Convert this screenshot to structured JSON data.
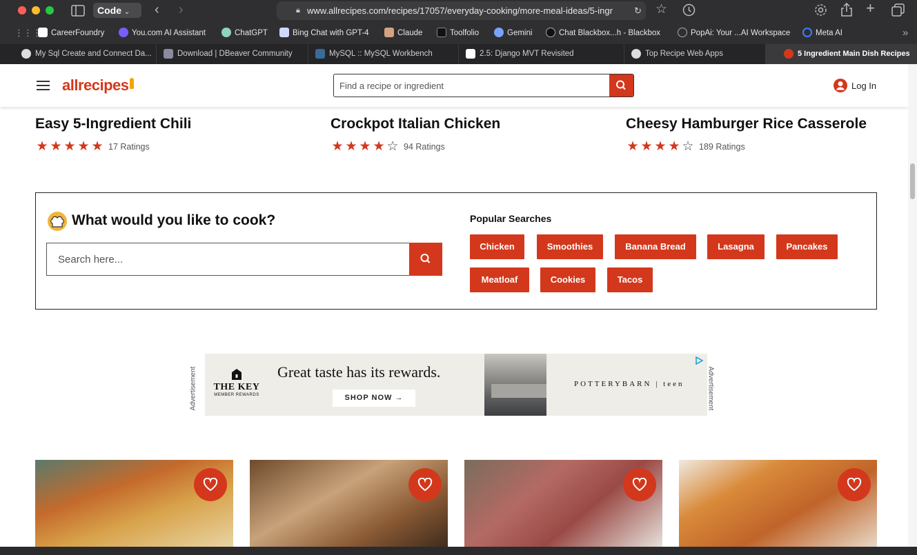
{
  "browser": {
    "app_menu": "Code",
    "url": "www.allrecipes.com/recipes/17057/everyday-cooking/more-meal-ideas/5-ingr",
    "bookmarks": [
      {
        "label": "CareerFoundry",
        "icon": "careerfoundry-icon"
      },
      {
        "label": "You.com AI Assistant",
        "icon": "youcom-icon"
      },
      {
        "label": "ChatGPT",
        "icon": "chatgpt-icon"
      },
      {
        "label": "Bing Chat with GPT-4",
        "icon": "bing-icon"
      },
      {
        "label": "Claude",
        "icon": "claude-icon"
      },
      {
        "label": "Toolfolio",
        "icon": "toolfolio-icon"
      },
      {
        "label": "Gemini",
        "icon": "gemini-icon"
      },
      {
        "label": "Chat Blackbox...h - Blackbox",
        "icon": "blackbox-icon"
      },
      {
        "label": "PopAi: Your ...AI Workspace",
        "icon": "globe-icon"
      },
      {
        "label": "Meta AI",
        "icon": "meta-icon"
      }
    ],
    "tabs": [
      {
        "label": "My Sql Create and Connect Da...",
        "active": false
      },
      {
        "label": "Download | DBeaver Community",
        "active": false
      },
      {
        "label": "MySQL :: MySQL Workbench",
        "active": false
      },
      {
        "label": "2.5: Django MVT Revisited",
        "active": false
      },
      {
        "label": "Top Recipe Web Apps",
        "active": false
      },
      {
        "label": "5 Ingredient Main Dish Recipes",
        "active": true
      }
    ]
  },
  "header": {
    "logo": "allrecipes",
    "search_placeholder": "Find a recipe or ingredient",
    "login_label": "Log In"
  },
  "recipes": [
    {
      "title": "Easy 5-Ingredient Chili",
      "stars": 5,
      "ratings": "17 Ratings"
    },
    {
      "title": "Crockpot Italian Chicken",
      "stars": 4,
      "ratings": "94 Ratings"
    },
    {
      "title": "Cheesy Hamburger Rice Casserole",
      "stars": 4,
      "ratings": "189 Ratings"
    }
  ],
  "cook": {
    "title": "What would you like to cook?",
    "search_placeholder": "Search here...",
    "popular_title": "Popular Searches",
    "chips": [
      "Chicken",
      "Smoothies",
      "Banana Bread",
      "Lasagna",
      "Pancakes",
      "Meatloaf",
      "Cookies",
      "Tacos"
    ]
  },
  "ad": {
    "label": "Advertisement",
    "brand": "THE KEY",
    "brand_sub": "MEMBER REWARDS",
    "headline": "Great taste has its rewards.",
    "cta": "SHOP NOW →",
    "partner": "POTTERYBARN | teen"
  },
  "colors": {
    "accent": "#d3381c",
    "text": "#111111"
  }
}
